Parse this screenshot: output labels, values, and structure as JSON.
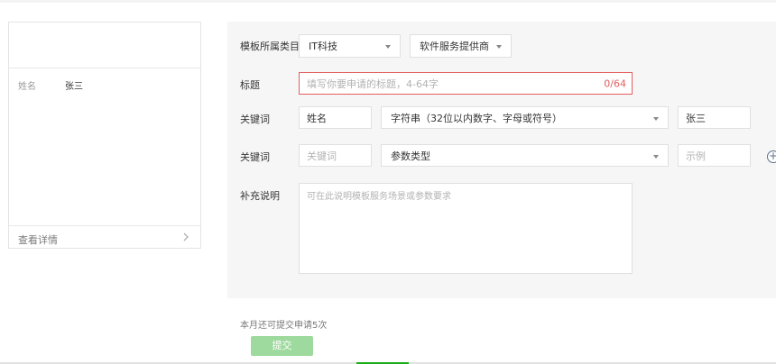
{
  "preview": {
    "field_label": "姓名",
    "field_value": "张三",
    "details_link": "查看详情"
  },
  "form": {
    "category": {
      "label": "模板所属类目",
      "primary": "IT科技",
      "secondary": "软件服务提供商"
    },
    "title": {
      "label": "标题",
      "placeholder": "填写你要申请的标题，4-64字",
      "counter": "0/64"
    },
    "keyword_rows": [
      {
        "label": "关键词",
        "name": "姓名",
        "type": "字符串（32位以内数字、字母或符号）",
        "example": "张三"
      },
      {
        "label": "关键词",
        "name_placeholder": "关键词",
        "type_placeholder": "参数类型",
        "example_placeholder": "示例"
      }
    ],
    "add_icon": "plus-circle-icon",
    "notes": {
      "label": "补充说明",
      "placeholder": "可在此说明模板服务场景或参数要求"
    }
  },
  "footer": {
    "remaining_text": "本月还可提交申请5次",
    "submit_label": "提交"
  },
  "colors": {
    "accent_green": "#1aad19",
    "disabled_green": "#9ed99d",
    "error_red": "#e15f5f",
    "panel_bg": "#f6f6f6"
  }
}
